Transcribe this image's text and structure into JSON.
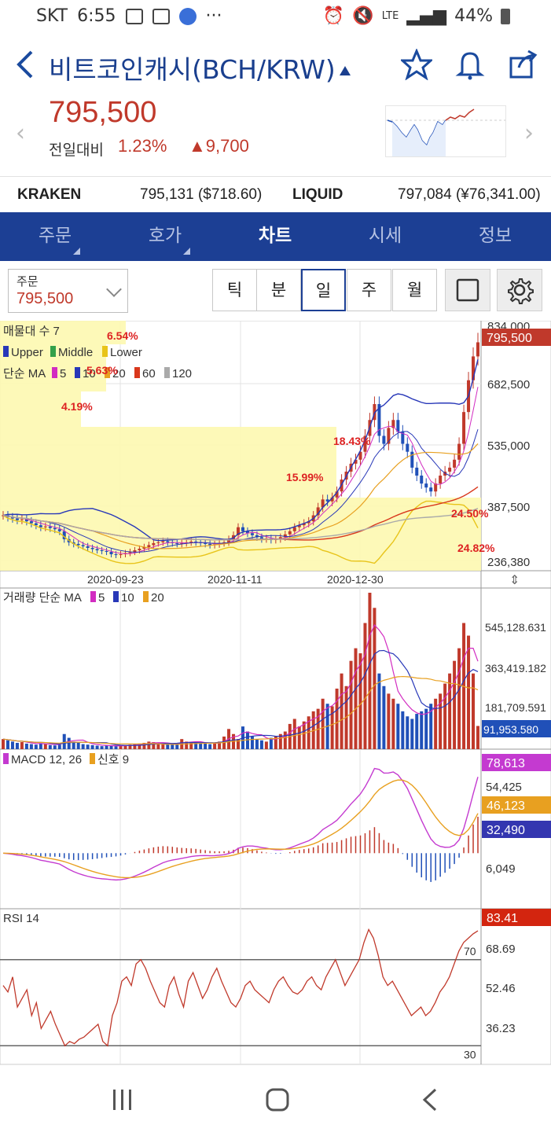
{
  "status": {
    "carrier": "SKT",
    "time": "6:55",
    "network": "LTE",
    "battery": "44%"
  },
  "header": {
    "title": "비트코인캐시(BCH/KRW)"
  },
  "price": {
    "current": "795,500",
    "change_label": "전일대비",
    "change_pct": "1.23%",
    "change_amt": "9,700",
    "direction": "up"
  },
  "exchanges": [
    {
      "name": "KRAKEN",
      "value": "795,131 ($718.60)"
    },
    {
      "name": "LIQUID",
      "value": "797,084 (¥76,341.00)"
    }
  ],
  "tabs": [
    {
      "label": "주문",
      "has_menu": true
    },
    {
      "label": "호가",
      "has_menu": true
    },
    {
      "label": "차트",
      "active": true
    },
    {
      "label": "시세"
    },
    {
      "label": "정보"
    }
  ],
  "toolbar": {
    "order_label": "주문",
    "order_value": "795,500",
    "periods": [
      "틱",
      "분",
      "일",
      "주",
      "월"
    ],
    "active_period": "일"
  },
  "colors": {
    "accent": "#1c3f94",
    "up": "#c0392b",
    "down": "#2050b8",
    "profile": "#fdf8b0"
  },
  "chart_data": {
    "type": "candlestick",
    "price_panel": {
      "profile_label": "매물대 수 7",
      "bollinger_labels": [
        "Upper",
        "Middle",
        "Lower"
      ],
      "ma_label": "단순 MA",
      "ma_periods": [
        "5",
        "10",
        "20",
        "60",
        "120"
      ],
      "profile_pcts": [
        "6.54%",
        "5.63%",
        "4.19%",
        "18.43%",
        "15.99%",
        "24.50%",
        "24.82%"
      ],
      "y_ticks": [
        "834,000",
        "682,500",
        "535,000",
        "387,500",
        "236,380"
      ],
      "last_price": "795,500",
      "x_ticks": [
        "2020-09-23",
        "2020-11-11",
        "2020-12-30"
      ],
      "close": [
        360000,
        355000,
        352000,
        348000,
        350000,
        345000,
        340000,
        335000,
        330000,
        332000,
        328000,
        325000,
        320000,
        300000,
        292000,
        288000,
        285000,
        282000,
        278000,
        275000,
        272000,
        270000,
        268000,
        262000,
        260000,
        262000,
        265000,
        268000,
        272000,
        276000,
        280000,
        285000,
        290000,
        292000,
        295000,
        292000,
        290000,
        288000,
        290000,
        292000,
        294000,
        292000,
        290000,
        288000,
        285000,
        287000,
        290000,
        292000,
        300000,
        310000,
        330000,
        320000,
        315000,
        310000,
        305000,
        300000,
        302000,
        298000,
        300000,
        305000,
        312000,
        320000,
        330000,
        335000,
        340000,
        345000,
        360000,
        380000,
        400000,
        395000,
        405000,
        420000,
        450000,
        470000,
        490000,
        500000,
        520000,
        560000,
        600000,
        640000,
        560000,
        540000,
        580000,
        600000,
        570000,
        540000,
        520000,
        480000,
        460000,
        440000,
        430000,
        420000,
        440000,
        460000,
        470000,
        480000,
        500000,
        540000,
        620000,
        700000,
        760000,
        795500
      ]
    },
    "volume_panel": {
      "label": "거래량 단순 MA",
      "ma_periods": [
        "5",
        "10",
        "20"
      ],
      "y_ticks": [
        "545,128.631",
        "363,419.182",
        "181,709.591"
      ],
      "last_value": "91,953.580",
      "values": [
        40000,
        35000,
        30000,
        25000,
        28000,
        22000,
        20000,
        18000,
        24000,
        20000,
        16000,
        15000,
        18000,
        60000,
        45000,
        30000,
        25000,
        20000,
        18000,
        16000,
        14000,
        12000,
        15000,
        13000,
        12000,
        14000,
        16000,
        18000,
        20000,
        22000,
        25000,
        30000,
        28000,
        24000,
        22000,
        20000,
        18000,
        25000,
        40000,
        30000,
        28000,
        26000,
        24000,
        22000,
        20000,
        25000,
        30000,
        50000,
        80000,
        60000,
        40000,
        90000,
        70000,
        50000,
        40000,
        35000,
        30000,
        45000,
        50000,
        60000,
        70000,
        100000,
        120000,
        90000,
        110000,
        130000,
        150000,
        160000,
        200000,
        180000,
        170000,
        240000,
        300000,
        250000,
        350000,
        400000,
        380000,
        500000,
        620000,
        560000,
        300000,
        250000,
        220000,
        200000,
        180000,
        150000,
        130000,
        120000,
        140000,
        150000,
        160000,
        180000,
        200000,
        220000,
        260000,
        300000,
        350000,
        400000,
        500000,
        450000,
        300000,
        91953
      ]
    },
    "macd_panel": {
      "label": "MACD 12, 26",
      "signal_label": "신호 9",
      "y_ticks": [
        "54,425",
        "6,049"
      ],
      "labels_right": [
        "78,613",
        "46,123",
        "32,490"
      ]
    },
    "rsi_panel": {
      "label": "RSI 14",
      "y_ticks": [
        "68.69",
        "52.46",
        "36.23"
      ],
      "level_high": "70",
      "level_low": "30",
      "last_value": "83.41",
      "values": [
        58,
        55,
        62,
        48,
        52,
        56,
        44,
        50,
        38,
        42,
        46,
        40,
        35,
        30,
        32,
        31,
        33,
        34,
        36,
        38,
        40,
        32,
        30,
        44,
        50,
        60,
        62,
        58,
        68,
        70,
        66,
        60,
        55,
        50,
        48,
        58,
        62,
        54,
        48,
        60,
        64,
        58,
        52,
        56,
        62,
        66,
        60,
        55,
        50,
        48,
        52,
        58,
        60,
        56,
        54,
        52,
        50,
        56,
        60,
        62,
        58,
        55,
        54,
        56,
        60,
        62,
        58,
        56,
        62,
        66,
        70,
        64,
        58,
        62,
        66,
        70,
        78,
        84,
        80,
        72,
        62,
        58,
        60,
        56,
        52,
        48,
        44,
        46,
        48,
        44,
        46,
        50,
        55,
        58,
        62,
        68,
        74,
        78,
        80,
        82,
        83.41
      ]
    }
  }
}
